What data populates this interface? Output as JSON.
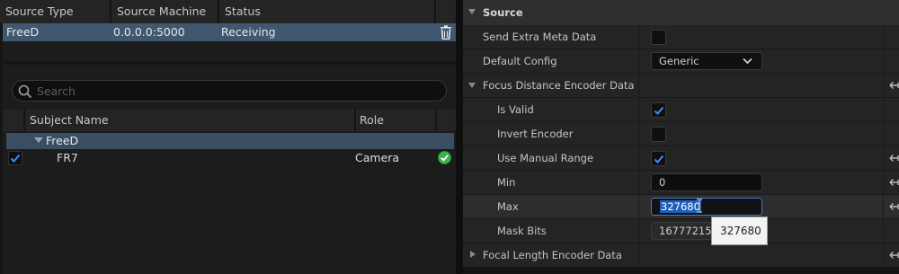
{
  "sources": {
    "columns": [
      "Source Type",
      "Source Machine",
      "Status"
    ],
    "rows": [
      {
        "type": "FreeD",
        "machine": "0.0.0.0:5000",
        "status": "Receiving"
      }
    ]
  },
  "subjects": {
    "search_placeholder": "Search",
    "columns": [
      "Subject Name",
      "Role"
    ],
    "groups": [
      {
        "name": "FreeD",
        "items": [
          {
            "name": "FR7",
            "role": "Camera",
            "enabled": true,
            "status_icon": "check-circle-icon"
          }
        ]
      }
    ]
  },
  "details": {
    "source_section": "Source",
    "send_extra_meta": {
      "label": "Send Extra Meta Data",
      "checked": false
    },
    "default_config": {
      "label": "Default Config",
      "value": "Generic"
    },
    "focus_distance": {
      "label": "Focus Distance Encoder Data",
      "is_valid": {
        "label": "Is Valid",
        "checked": true
      },
      "invert_encoder": {
        "label": "Invert Encoder",
        "checked": false
      },
      "use_manual_range": {
        "label": "Use Manual Range",
        "checked": true
      },
      "min": {
        "label": "Min",
        "value": "0"
      },
      "max": {
        "label": "Max",
        "value": "327680"
      },
      "mask_bits": {
        "label": "Mask Bits",
        "value": "16777215"
      }
    },
    "focal_length": {
      "label": "Focal Length Encoder Data"
    },
    "tooltip": "327680"
  },
  "colors": {
    "selection": "#3f5870",
    "accent_blue": "#1f5fb8",
    "ok_green": "#3bb24a"
  }
}
